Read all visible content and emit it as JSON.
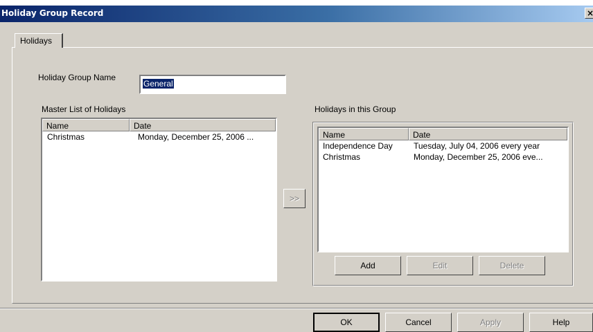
{
  "window": {
    "title": "Holiday Group Record",
    "close_glyph": "×"
  },
  "tabs": [
    {
      "label": "Holidays",
      "active": true
    }
  ],
  "form": {
    "group_name_label": "Holiday Group Name",
    "group_name_value": "General"
  },
  "master_list": {
    "label": "Master List of Holidays",
    "columns": [
      "Name",
      "Date"
    ],
    "rows": [
      {
        "name": "Christmas",
        "date": "Monday, December 25, 2006 ..."
      }
    ]
  },
  "move_button": {
    "label": ">>"
  },
  "group_list": {
    "label": "Holidays in this Group",
    "columns": [
      "Name",
      "Date"
    ],
    "rows": [
      {
        "name": "Independence Day",
        "date": "Tuesday, July 04, 2006 every year"
      },
      {
        "name": "Christmas",
        "date": "Monday, December 25, 2006 eve..."
      }
    ],
    "buttons": {
      "add": "Add",
      "edit": "Edit",
      "delete": "Delete"
    }
  },
  "footer": {
    "ok": "OK",
    "cancel": "Cancel",
    "apply": "Apply",
    "help": "Help"
  },
  "colors": {
    "dialog": "#d4d0c8",
    "titlebar_start": "#0a246a",
    "titlebar_end": "#a6caf0",
    "selection": "#0a246a"
  }
}
